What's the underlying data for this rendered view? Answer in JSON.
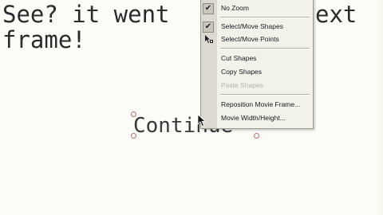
{
  "slide": {
    "line1": "See? it went",
    "line1_tail": "ext",
    "line2": "frame!",
    "button_text": "Continue"
  },
  "context_menu": {
    "items": [
      {
        "label": "No Zoom",
        "checked": true,
        "enabled": true
      },
      {
        "label": "Select/Move Shapes",
        "checked": true,
        "enabled": true
      },
      {
        "label": "Select/Move Points",
        "icon": "move-points-icon",
        "enabled": true
      },
      {
        "label": "Cut Shapes",
        "enabled": true
      },
      {
        "label": "Copy Shapes",
        "enabled": true
      },
      {
        "label": "Paste Shapes",
        "enabled": false
      },
      {
        "label": "Reposition Movie Frame...",
        "enabled": true
      },
      {
        "label": "Movie Width/Height...",
        "enabled": true
      }
    ]
  },
  "icons": {
    "checkmark": "check-icon",
    "points": "move-points-icon",
    "cursor": "arrow-cursor-icon"
  },
  "colors": {
    "canvas": "#fbfbf7",
    "menu_background": "#f2f1ea",
    "menu_gutter": "#dcdad0",
    "disabled_text": "#b6b5ad",
    "handle": "#b27070"
  }
}
